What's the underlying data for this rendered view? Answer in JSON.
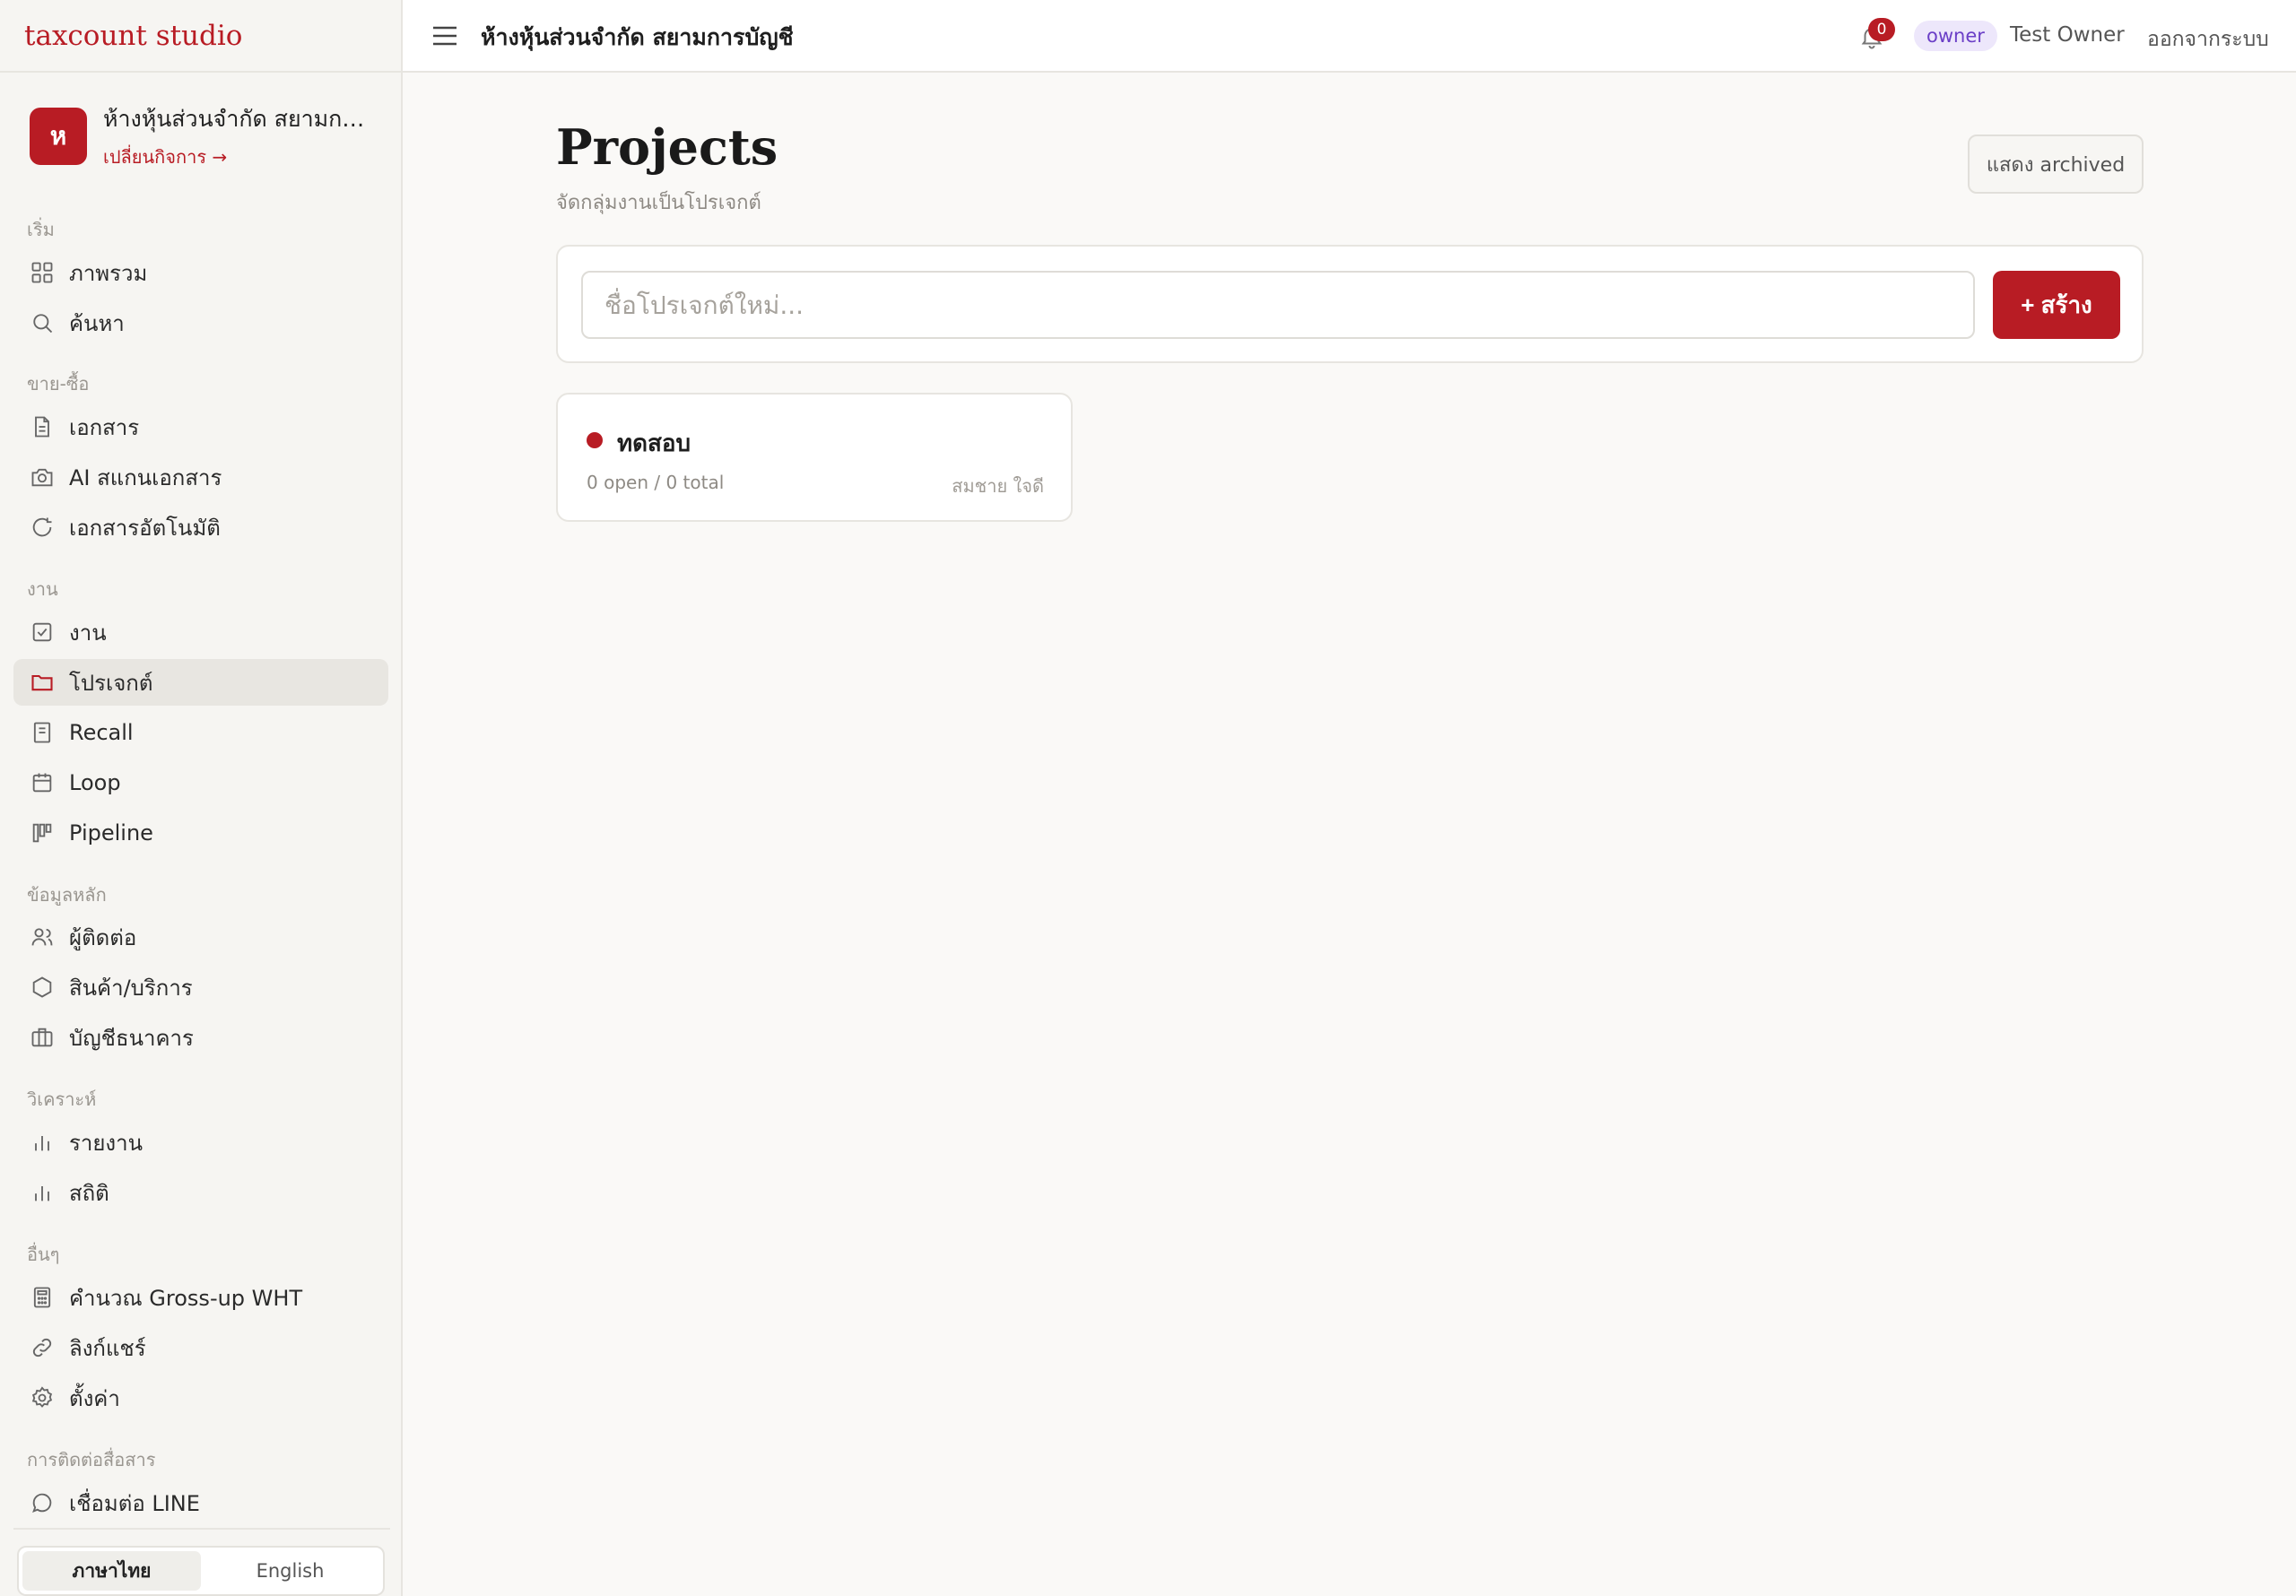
{
  "brand": "taxcount studio",
  "org": {
    "initial": "ห",
    "name": "ห้างหุ้นส่วนจำกัด สยามการ...",
    "switch_label": "เปลี่ยนกิจการ →"
  },
  "sections": {
    "start": "เริ่ม",
    "sales": "ขาย-ซื้อ",
    "work": "งาน",
    "master": "ข้อมูลหลัก",
    "analyze": "วิเคราะห์",
    "other": "อื่นๆ",
    "comm": "การติดต่อสื่อสาร"
  },
  "nav": {
    "overview": "ภาพรวม",
    "search": "ค้นหา",
    "documents": "เอกสาร",
    "ai_scan": "AI สแกนเอกสาร",
    "auto_docs": "เอกสารอัตโนมัติ",
    "tasks": "งาน",
    "projects": "โปรเจกต์",
    "recall": "Recall",
    "loop": "Loop",
    "pipeline": "Pipeline",
    "contacts": "ผู้ติดต่อ",
    "products": "สินค้า/บริการ",
    "bank": "บัญชีธนาคาร",
    "reports": "รายงาน",
    "stats": "สถิติ",
    "grossup": "คำนวณ Gross-up WHT",
    "share_links": "ลิงก์แชร์",
    "settings": "ตั้งค่า",
    "line": "เชื่อมต่อ LINE"
  },
  "lang": {
    "thai": "ภาษาไทย",
    "english": "English",
    "active": "thai"
  },
  "topbar": {
    "title": "ห้างหุ้นส่วนจำกัด สยามการบัญชี",
    "notifications": "0",
    "role": "owner",
    "user": "Test Owner",
    "logout": "ออกจากระบบ"
  },
  "page": {
    "title": "Projects",
    "subtitle": "จัดกลุ่มงานเป็นโปรเจกต์",
    "archived_button": "แสดง archived",
    "input_placeholder": "ชื่อโปรเจกต์ใหม่...",
    "create_button": "+ สร้าง"
  },
  "projects": [
    {
      "name": "ทดสอบ",
      "stats": "0 open / 0 total",
      "owner": "สมชาย ใจดี",
      "color": "#b81c24"
    }
  ],
  "colors": {
    "accent": "#b81c24",
    "role_bg": "#ede7fb",
    "role_text": "#6b3fc7"
  }
}
